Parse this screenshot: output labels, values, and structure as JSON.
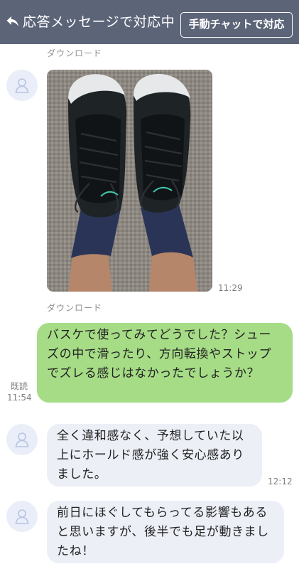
{
  "header": {
    "title": "応答メッセージで対応中",
    "manual_button": "手動チャットで対応"
  },
  "colors": {
    "header_bg": "#5c6478",
    "sent_bubble": "#a6dc86",
    "received_bubble": "#eceff6",
    "avatar_bg": "#e9eef9"
  },
  "messages": {
    "download_label_1": "ダウンロード",
    "photo_time": "11:29",
    "download_label_2": "ダウンロード",
    "sent_text": "バスケで使ってみてどうでした？シューズの中で滑ったり、方向転換やストップでズレる感じはなかったでしょうか？",
    "sent_read": "既読",
    "sent_time": "11:54",
    "reply1_text": "全く違和感なく、予想していた以上にホールド感が強く安心感ありました。",
    "reply1_time": "12:12",
    "reply2_text": "前日にほぐしてもらってる影響もあると思いますが、後半でも足が動きましたね！"
  }
}
